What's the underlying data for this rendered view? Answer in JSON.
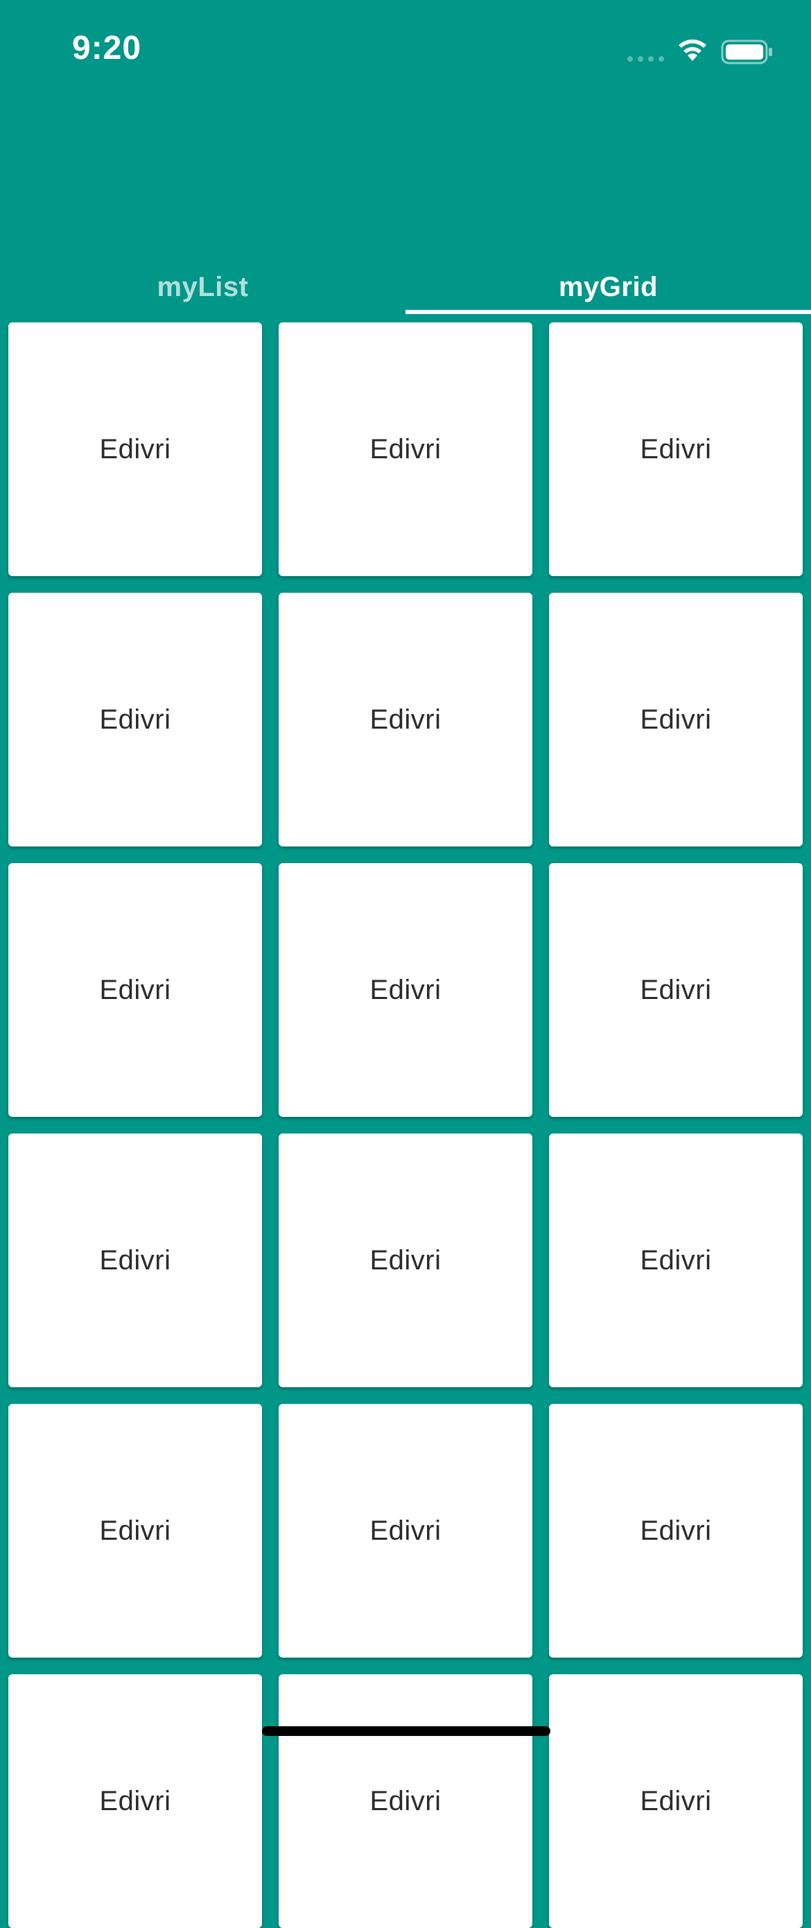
{
  "status_bar": {
    "time": "9:20",
    "icons": [
      "cellular-signal-icon",
      "wifi-icon",
      "battery-icon"
    ]
  },
  "colors": {
    "app_bar": "#009688",
    "card_background": "#ffffff",
    "card_text": "#2b2b2b",
    "tab_inactive_text": "rgba(255,255,255,0.7)",
    "tab_active_text": "#ffffff",
    "home_indicator": "#000000"
  },
  "tabs": [
    {
      "label": "myList",
      "selected": false
    },
    {
      "label": "myGrid",
      "selected": true
    }
  ],
  "grid": {
    "columns": 3,
    "items": [
      {
        "label": "Edivri"
      },
      {
        "label": "Edivri"
      },
      {
        "label": "Edivri"
      },
      {
        "label": "Edivri"
      },
      {
        "label": "Edivri"
      },
      {
        "label": "Edivri"
      },
      {
        "label": "Edivri"
      },
      {
        "label": "Edivri"
      },
      {
        "label": "Edivri"
      },
      {
        "label": "Edivri"
      },
      {
        "label": "Edivri"
      },
      {
        "label": "Edivri"
      },
      {
        "label": "Edivri"
      },
      {
        "label": "Edivri"
      },
      {
        "label": "Edivri"
      },
      {
        "label": "Edivri"
      },
      {
        "label": "Edivri"
      },
      {
        "label": "Edivri"
      }
    ]
  }
}
